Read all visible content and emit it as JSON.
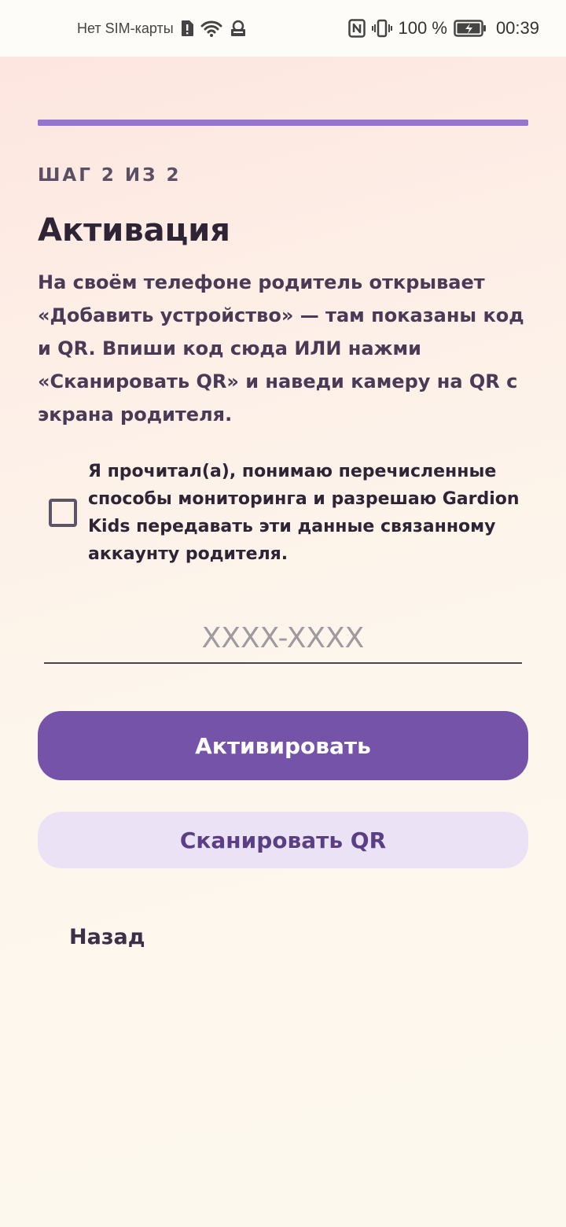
{
  "status_bar": {
    "carrier": "Нет SIM-карты",
    "battery_percent": "100 %",
    "time": "00:39",
    "icons": [
      "sim-alert-icon",
      "wifi-icon",
      "vpn-icon",
      "nfc-icon",
      "vibrate-icon",
      "battery-charging-icon"
    ]
  },
  "progress": {
    "value": 1.0,
    "color": "#9575cd"
  },
  "step_label": "ШАГ 2 ИЗ 2",
  "title": "Активация",
  "description": "На своём телефоне родитель открывает «Добавить устройство» — там показаны код и QR. Впиши код сюда ИЛИ нажми «Сканировать QR» и наведи камеру на QR с экрана родителя.",
  "consent": {
    "checked": false,
    "text": "Я прочитал(а), понимаю перечисленные способы мониторинга и разрешаю Gardion Kids передавать эти данные связанному аккаунту родителя."
  },
  "code_input": {
    "value": "",
    "placeholder": "XXXX-XXXX"
  },
  "buttons": {
    "activate": "Активировать",
    "scan_qr": "Сканировать QR",
    "back": "Назад"
  },
  "colors": {
    "primary": "#7453a9",
    "secondary_bg": "#ece2f6",
    "secondary_text": "#5a3f85",
    "accent_bar": "#9575cd"
  }
}
